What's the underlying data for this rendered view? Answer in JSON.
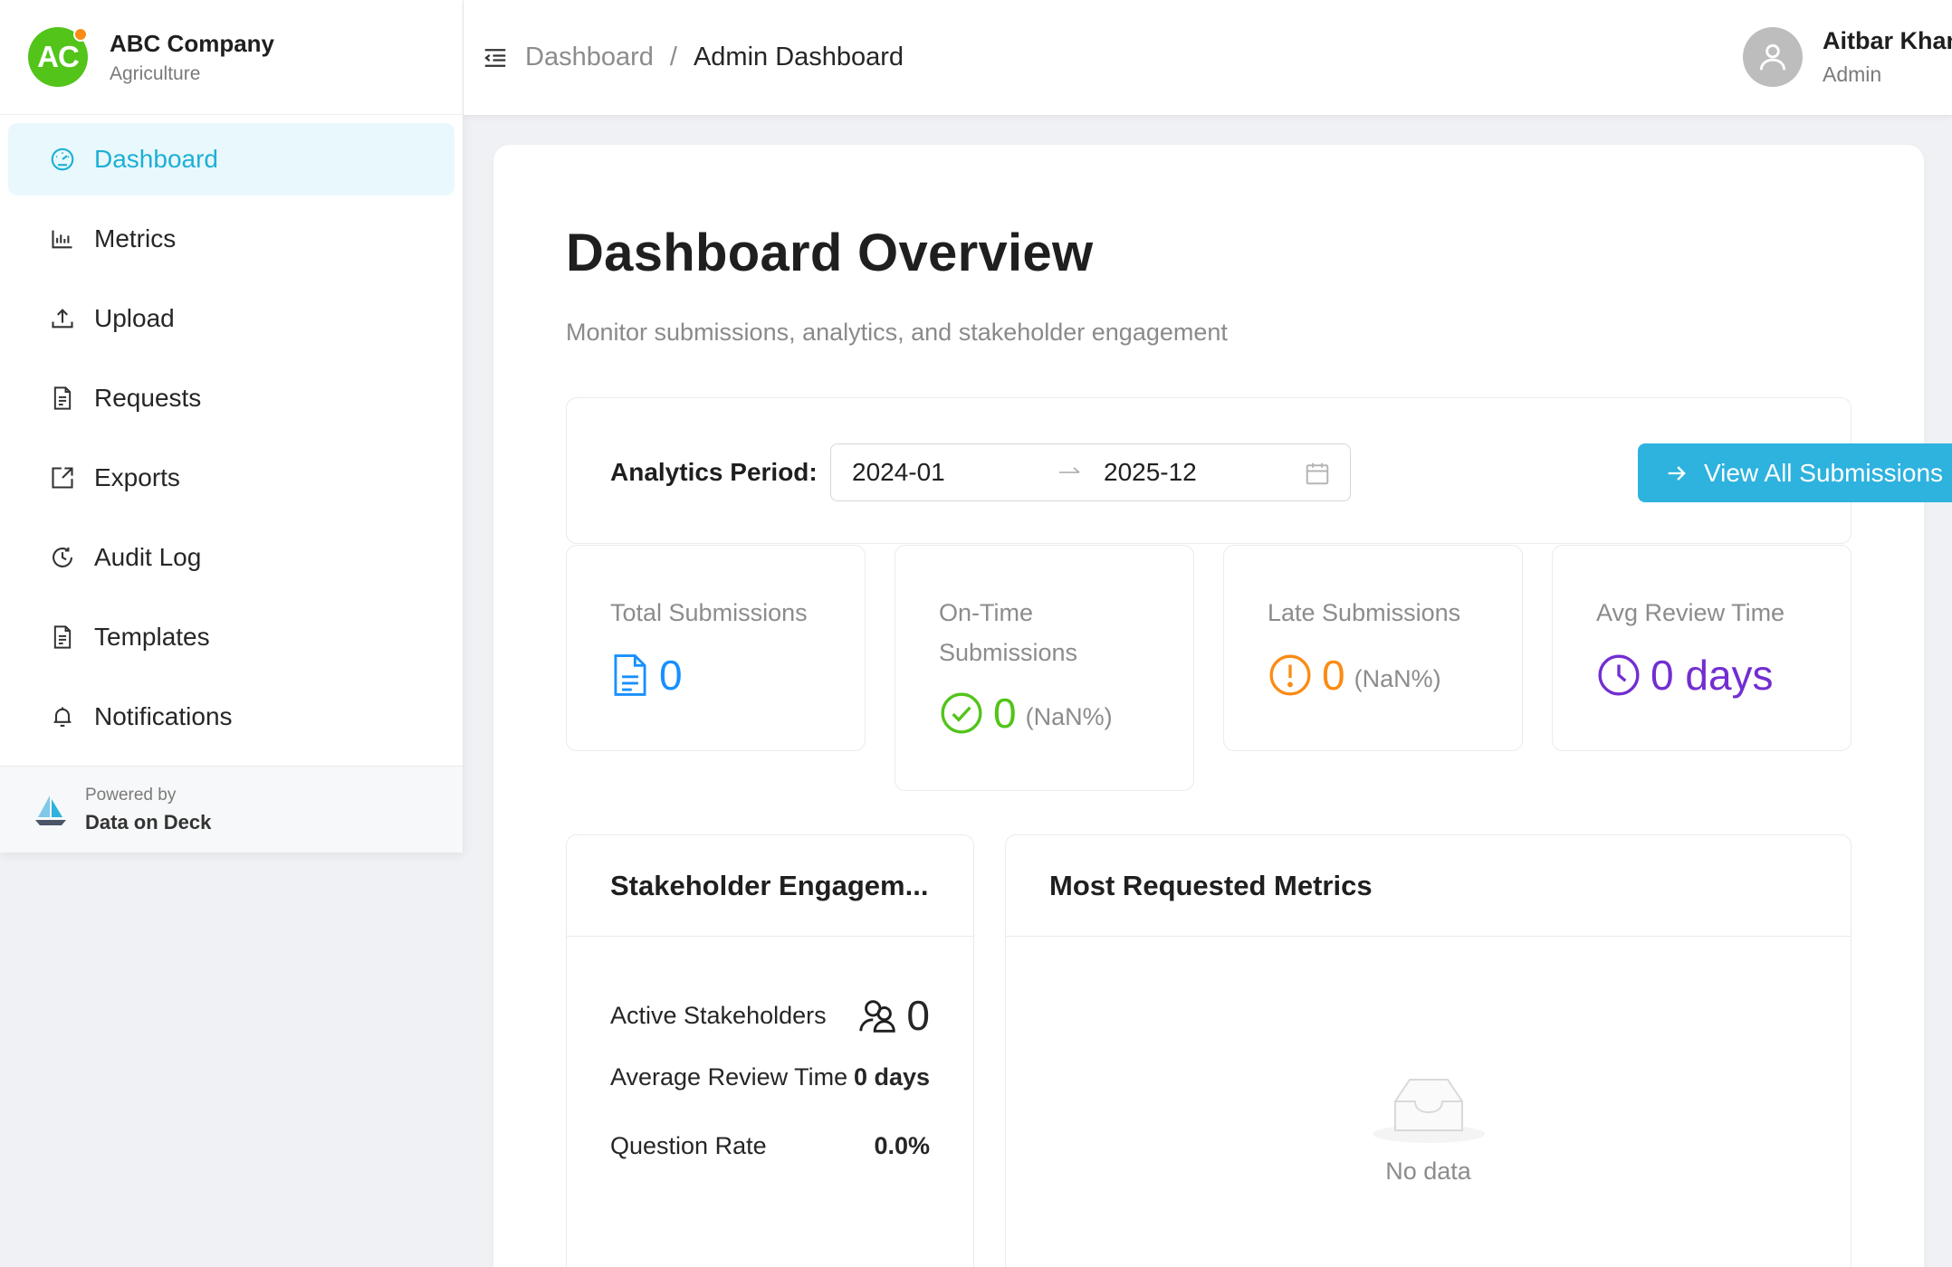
{
  "colors": {
    "accent": "#1cb0d6",
    "primary_button": "#2eb2de",
    "brand_logo": "#52c41a",
    "success": "#52c41a",
    "warning": "#fa8c16",
    "purple": "#722ed1",
    "blue": "#1890ff"
  },
  "brand": {
    "logo_text": "AC",
    "name": "ABC Company",
    "subtitle": "Agriculture"
  },
  "sidebar": {
    "items": [
      {
        "label": "Dashboard",
        "icon": "dashboard-icon",
        "active": true
      },
      {
        "label": "Metrics",
        "icon": "bar-chart-icon"
      },
      {
        "label": "Upload",
        "icon": "upload-icon"
      },
      {
        "label": "Requests",
        "icon": "document-icon"
      },
      {
        "label": "Exports",
        "icon": "export-icon"
      },
      {
        "label": "Audit Log",
        "icon": "history-icon"
      },
      {
        "label": "Templates",
        "icon": "document-icon"
      },
      {
        "label": "Notifications",
        "icon": "bell-icon"
      }
    ],
    "footer": {
      "powered_by": "Powered by",
      "name": "Data on Deck"
    }
  },
  "header": {
    "breadcrumb": [
      "Dashboard",
      "Admin Dashboard"
    ],
    "separator": "/",
    "user": {
      "name": "Aitbar Khan",
      "role": "Admin"
    }
  },
  "main": {
    "title": "Dashboard Overview",
    "subtitle": "Monitor submissions, analytics, and stakeholder engagement",
    "period": {
      "label": "Analytics Period:",
      "start": "2024-01",
      "end": "2025-12",
      "button": "View All Submissions"
    },
    "stats": {
      "total": {
        "title": "Total Submissions",
        "value": "0",
        "icon": "file-icon"
      },
      "ontime": {
        "title": "On-Time Submissions",
        "value": "0",
        "suffix": "(NaN%)",
        "icon": "check-circle-icon"
      },
      "late": {
        "title": "Late Submissions",
        "value": "0",
        "suffix": "(NaN%)",
        "icon": "exclamation-circle-icon"
      },
      "review": {
        "title": "Avg Review Time",
        "value": "0 days",
        "icon": "clock-icon"
      }
    },
    "engagement": {
      "title": "Stakeholder Engagem...",
      "active_label": "Active Stakeholders",
      "active_value": "0",
      "avg_label": "Average Review Time",
      "avg_value": "0 days",
      "question_label": "Question Rate",
      "question_value": "0.0%"
    },
    "metrics": {
      "title": "Most Requested Metrics",
      "empty_text": "No data"
    }
  }
}
